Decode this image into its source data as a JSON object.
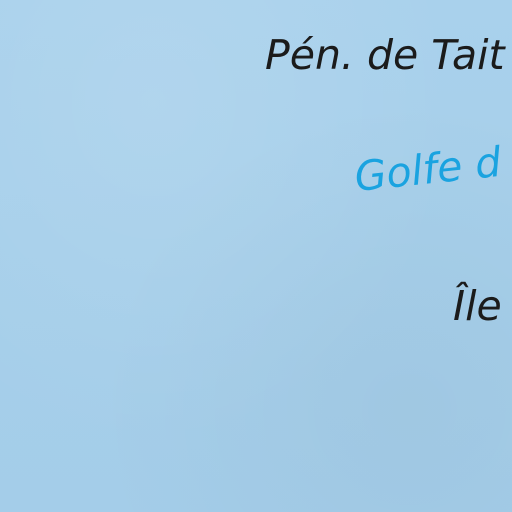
{
  "map": {
    "water_color": "#a6cfea",
    "labels": {
      "peninsula": "Pén. de Tait",
      "gulf": "Golfe d",
      "island": "Île"
    },
    "colors": {
      "land_label": "#1b1b1b",
      "water_label": "#1aa3e0"
    }
  }
}
